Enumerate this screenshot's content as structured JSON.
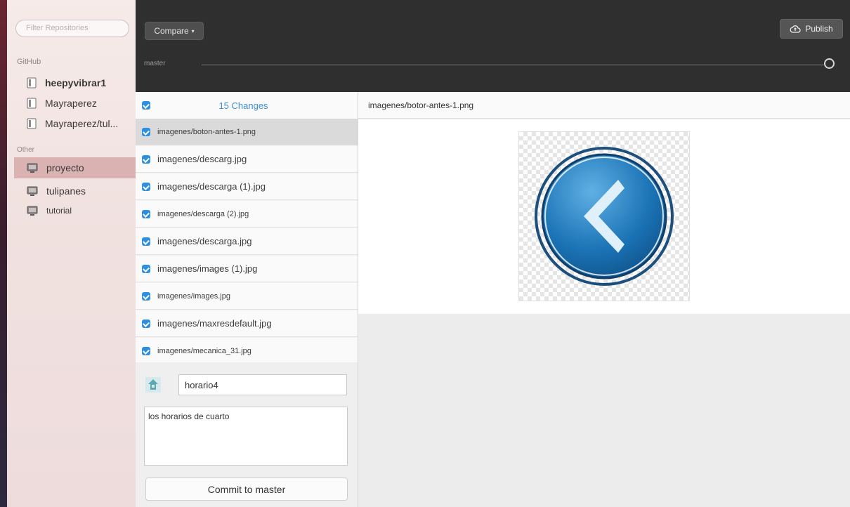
{
  "sidebar": {
    "filter_placeholder": "Filter Repositories",
    "github_label": "GitHub",
    "github_repos": [
      {
        "label": "heepyvibrar1"
      },
      {
        "label": "Mayraperez"
      },
      {
        "label": "Mayraperez/tul..."
      }
    ],
    "other_label": "Other",
    "other_repos": [
      {
        "label": "proyecto",
        "selected": true
      },
      {
        "label": "tulipanes"
      },
      {
        "label": "tutorial"
      }
    ]
  },
  "toolbar": {
    "compare_label": "Compare",
    "publish_label": "Publish",
    "branch": "master"
  },
  "changes": {
    "title": "15 Changes",
    "files": [
      {
        "name": "imagenes/boton-antes-1.png",
        "selected": true
      },
      {
        "name": "imagenes/descarg.jpg"
      },
      {
        "name": "imagenes/descarga (1).jpg"
      },
      {
        "name": "imagenes/descarga (2).jpg"
      },
      {
        "name": "imagenes/descarga.jpg"
      },
      {
        "name": "imagenes/images (1).jpg"
      },
      {
        "name": "imagenes/images.jpg"
      },
      {
        "name": "imagenes/maxresdefault.jpg"
      },
      {
        "name": "imagenes/mecanica_31.jpg"
      }
    ]
  },
  "commit": {
    "summary": "horario4",
    "description": "los horarios de cuarto",
    "button_label": "Commit to master"
  },
  "diff": {
    "file_path": "imagenes/botor-antes-1.png"
  },
  "colors": {
    "accent": "#2d8fe0",
    "toolbar": "#2f2f2f",
    "selected_repo": "#dbb2b2"
  }
}
